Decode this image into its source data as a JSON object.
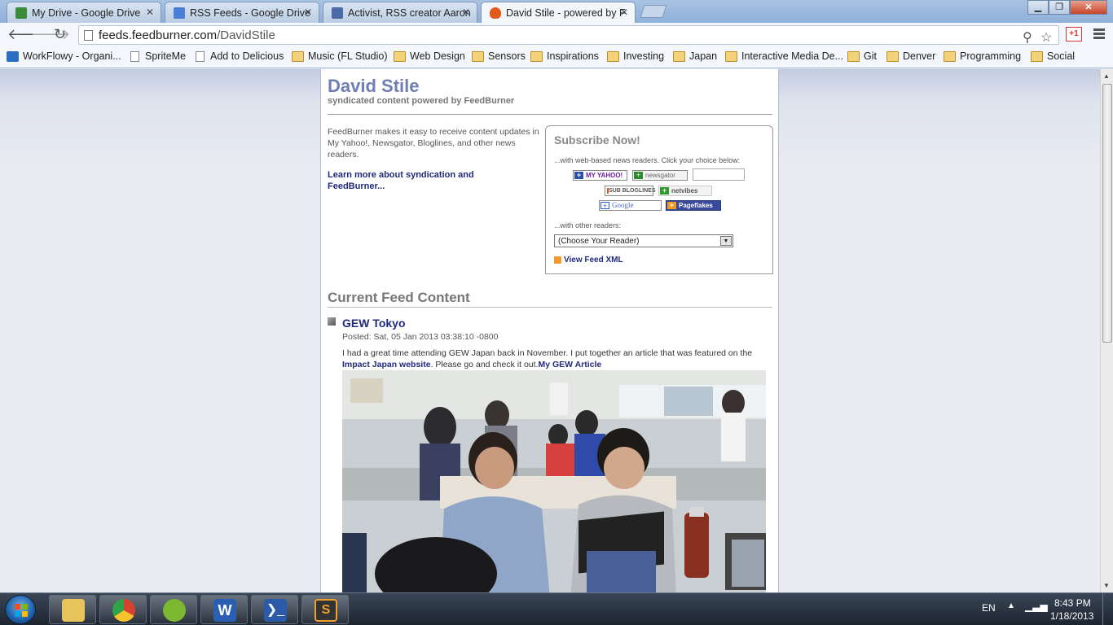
{
  "browser": {
    "tabs": [
      {
        "title": "My Drive - Google Drive",
        "active": false,
        "icon": "google-drive-icon",
        "color": "#3a8c3a"
      },
      {
        "title": "RSS Feeds - Google Drive",
        "active": false,
        "icon": "google-docs-icon",
        "color": "#4a7fd8"
      },
      {
        "title": "Activist, RSS creator Aaron",
        "active": false,
        "icon": "document-icon",
        "color": "#4a6aa8"
      },
      {
        "title": "David Stile - powered by F",
        "active": true,
        "icon": "feedburner-flame-icon",
        "color": "#e05a1c"
      }
    ],
    "url_host": "feeds.feedburner.com",
    "url_path": "/DavidStile",
    "gplus_label": "+1",
    "bookmarks": [
      {
        "label": "WorkFlowy - Organi...",
        "type": "app"
      },
      {
        "label": "SpriteMe",
        "type": "page"
      },
      {
        "label": "Add to Delicious",
        "type": "page"
      },
      {
        "label": "Music (FL Studio)",
        "type": "folder"
      },
      {
        "label": "Web Design",
        "type": "folder"
      },
      {
        "label": "Sensors",
        "type": "folder"
      },
      {
        "label": "Inspirations",
        "type": "folder"
      },
      {
        "label": "Investing",
        "type": "folder"
      },
      {
        "label": "Japan",
        "type": "folder"
      },
      {
        "label": "Interactive Media De...",
        "type": "folder"
      },
      {
        "label": "Git",
        "type": "folder"
      },
      {
        "label": "Denver",
        "type": "folder"
      },
      {
        "label": "Programming",
        "type": "folder"
      },
      {
        "label": "Social",
        "type": "folder"
      }
    ]
  },
  "feed_page": {
    "title": "David Stile",
    "subtitle": "syndicated content powered by FeedBurner",
    "intro": "FeedBurner makes it easy to receive content updates in My Yahoo!, Newsgator, Bloglines, and other news readers.",
    "learn_more": "Learn more about syndication and FeedBurner...",
    "subscribe": {
      "heading": "Subscribe Now!",
      "web_readers_label": "...with web-based news readers. Click your choice below:",
      "buttons": {
        "my_yahoo": "MY YAHOO!",
        "newsgator": "newsgator",
        "bloglines": "SUB BLOGLINES",
        "netvibes": "netvibes",
        "google": "Google",
        "pageflakes": "Pageflakes"
      },
      "other_readers_label": "...with other readers:",
      "reader_select_value": "(Choose Your Reader)",
      "view_feed_xml": "View Feed XML"
    },
    "current_feed_heading": "Current Feed Content",
    "entries": [
      {
        "title": "GEW Tokyo",
        "posted": "Posted: Sat, 05 Jan 2013 03:38:10 -0800",
        "body_text": "I had a great time attending GEW Japan back in November. I put together an article that was featured on the",
        "link1": "Impact Japan website",
        "mid_text": ". Please go and check it out.",
        "link2": "My GEW Article"
      }
    ]
  },
  "taskbar": {
    "items": [
      {
        "name": "windows-explorer",
        "color": "#e8c25a"
      },
      {
        "name": "google-chrome",
        "color": "#d8412f"
      },
      {
        "name": "spotify",
        "color": "#7cb82f"
      },
      {
        "name": "microsoft-word",
        "color": "#2b5fb4"
      },
      {
        "name": "powershell",
        "color": "#2a5aa8"
      },
      {
        "name": "sublime-text",
        "color": "#f2a02c"
      }
    ],
    "language": "EN",
    "time": "8:43 PM",
    "date": "1/18/2013"
  }
}
